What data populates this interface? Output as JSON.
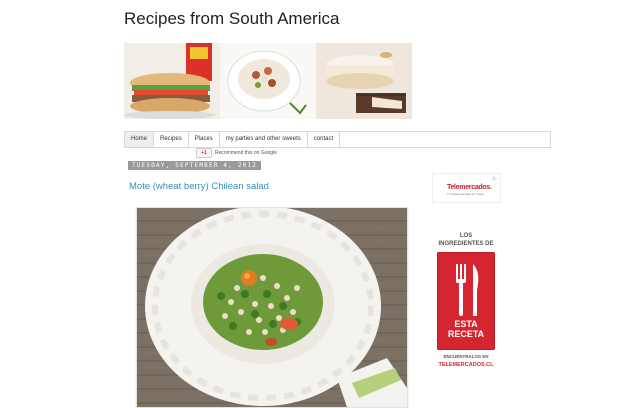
{
  "blog": {
    "title": "Recipes from South America"
  },
  "tabs": [
    {
      "label": "Home"
    },
    {
      "label": "Recipes"
    },
    {
      "label": "Places"
    },
    {
      "label": "my parties and other sweets"
    },
    {
      "label": "contact"
    }
  ],
  "gplus": {
    "button": "+1",
    "text": "Recommend this on Google"
  },
  "post": {
    "date": "Tuesday, September 4, 2012",
    "title": "Mote (wheat berry) Chilean salad"
  },
  "sidebar": {
    "ad_small": {
      "logo": "Telemercados.",
      "tagline": "Tu Supermercado en Línea",
      "play_icon": "▷"
    },
    "ad_big": {
      "line1": "LOS",
      "line2": "INGREDIENTES DE",
      "line3": "ESTA",
      "line4": "RECETA",
      "line5": "ENCUÉNTRALOS EN",
      "url": "TELEMERCADOS.CL"
    }
  },
  "colors": {
    "link": "#3b8fb5",
    "ad_red": "#d42630",
    "date_bg": "#9a9a9a"
  }
}
